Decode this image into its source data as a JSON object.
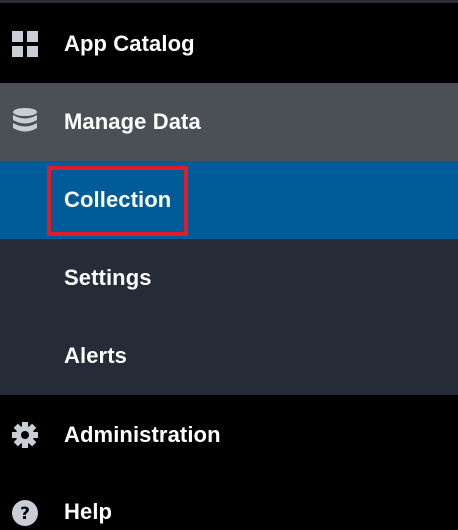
{
  "sidebar": {
    "items": [
      {
        "label": "App Catalog",
        "icon": "grid-icon"
      },
      {
        "label": "Manage Data",
        "icon": "database-icon"
      },
      {
        "label": "Collection",
        "icon": ""
      },
      {
        "label": "Settings",
        "icon": ""
      },
      {
        "label": "Alerts",
        "icon": ""
      },
      {
        "label": "Administration",
        "icon": "gear-icon"
      },
      {
        "label": "Help",
        "icon": "help-icon"
      }
    ],
    "selected": "Collection"
  },
  "colors": {
    "background": "#000000",
    "expanded_parent": "#4b4f56",
    "selected": "#005c99",
    "submenu": "#252c38",
    "highlight": "#e11d2a",
    "icon": "#c9ced6"
  }
}
